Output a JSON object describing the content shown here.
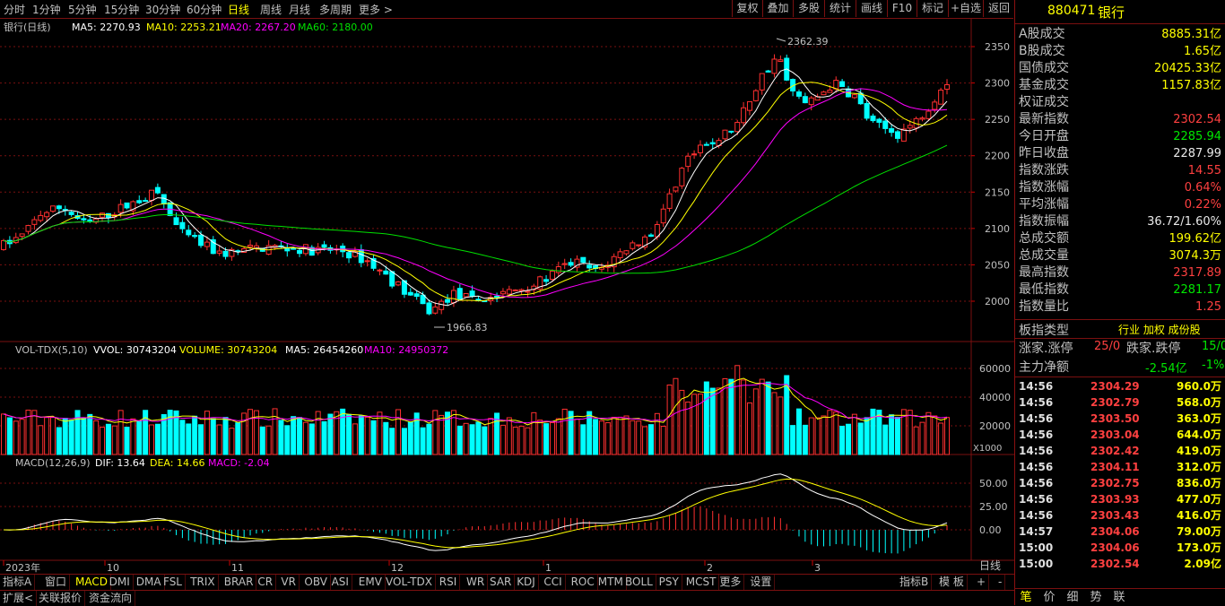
{
  "toolbar": {
    "periods": [
      "分时",
      "1分钟",
      "5分钟",
      "15分钟",
      "30分钟",
      "60分钟",
      "日线",
      "周线",
      "月线",
      "多周期",
      "更多 >"
    ],
    "selected_period": "日线",
    "right_buttons": [
      "复权",
      "叠加",
      "多股",
      "统计",
      "画线",
      "F10",
      "标记",
      "+自选",
      "返回"
    ]
  },
  "main_panel": {
    "title": "银行(日线)",
    "ma5": "MA5: 2270.93",
    "ma10": "MA10: 2253.21",
    "ma20": "MA20: 2267.20",
    "ma60": "MA60: 2180.00",
    "high_label": "2362.39",
    "low_label": "1966.83",
    "price_ticks": [
      "2350",
      "2300",
      "2250",
      "2200",
      "2150",
      "2100",
      "2050",
      "2000"
    ]
  },
  "vol_panel": {
    "title": "VOL-TDX(5,10)",
    "vvol": "VVOL: 30743204",
    "volume": "VOLUME: 30743204",
    "ma5": "MA5: 26454260",
    "ma10": "MA10: 24950372",
    "ticks": [
      "60000",
      "40000",
      "20000"
    ],
    "unit": "X1000"
  },
  "macd_panel": {
    "title": "MACD(12,26,9)",
    "dif": "DIF: 13.64",
    "dea": "DEA: 14.66",
    "macd": "MACD: -2.04",
    "ticks": [
      "50.00",
      "25.00",
      "0.00"
    ]
  },
  "date_axis": {
    "labels": [
      "2023年",
      "10",
      "11",
      "12",
      "1",
      "2",
      "3"
    ],
    "right_label": "日线"
  },
  "bottom_tabs": [
    "指标A",
    "窗口",
    "MACD",
    "DMI",
    "DMA",
    "FSL",
    "TRIX",
    "BRAR",
    "CR",
    "VR",
    "OBV",
    "ASI",
    "EMV",
    "VOL-TDX",
    "RSI",
    "WR",
    "SAR",
    "KDJ",
    "CCI",
    "ROC",
    "MTM",
    "BOLL",
    "PSY",
    "MCST",
    "更多",
    "设置"
  ],
  "bottom_tabs_selected": "MACD",
  "bottom_right_tabs": [
    "指标B",
    "模 板",
    "+",
    "-"
  ],
  "bottom_tabs2": [
    "扩展<",
    "关联报价",
    "资金流向"
  ],
  "quote": {
    "code": "880471",
    "name": "银行",
    "rows": [
      {
        "label": "A股成交",
        "value": "8885.31亿",
        "color": "yel"
      },
      {
        "label": "B股成交",
        "value": "1.65亿",
        "color": "yel"
      },
      {
        "label": "国债成交",
        "value": "20425.33亿",
        "color": "yel"
      },
      {
        "label": "基金成交",
        "value": "1157.83亿",
        "color": "yel"
      },
      {
        "label": "权证成交",
        "value": "",
        "color": "yel"
      },
      {
        "label": "最新指数",
        "value": "2302.54",
        "color": "red"
      },
      {
        "label": "今日开盘",
        "value": "2285.94",
        "color": "grn"
      },
      {
        "label": "昨日收盘",
        "value": "2287.99",
        "color": "wht"
      },
      {
        "label": "指数涨跌",
        "value": "14.55",
        "color": "red"
      },
      {
        "label": "指数涨幅",
        "value": "0.64%",
        "color": "red"
      },
      {
        "label": "平均涨幅",
        "value": "0.22%",
        "color": "red"
      },
      {
        "label": "指数振幅",
        "value": "36.72/1.60%",
        "color": "wht"
      },
      {
        "label": "总成交额",
        "value": "199.62亿",
        "color": "yel"
      },
      {
        "label": "总成交量",
        "value": "3074.3万",
        "color": "yel"
      },
      {
        "label": "最高指数",
        "value": "2317.89",
        "color": "red"
      },
      {
        "label": "最低指数",
        "value": "2281.17",
        "color": "grn"
      },
      {
        "label": "指数量比",
        "value": "1.25",
        "color": "red"
      }
    ],
    "type_label": "板指类型",
    "type_value": "行业 加权 成份股",
    "up_label": "涨家.涨停",
    "up_value": "25/0",
    "down_label": "跌家.跌停",
    "down_value": "15/0",
    "flow_label": "主力净额",
    "flow_value": "-2.54亿",
    "flow_pct": "-1%",
    "ticks": [
      {
        "t": "14:56",
        "p": "2304.29",
        "v": "960.0万"
      },
      {
        "t": "14:56",
        "p": "2302.79",
        "v": "568.0万"
      },
      {
        "t": "14:56",
        "p": "2303.50",
        "v": "363.0万"
      },
      {
        "t": "14:56",
        "p": "2303.04",
        "v": "644.0万"
      },
      {
        "t": "14:56",
        "p": "2302.42",
        "v": "419.0万"
      },
      {
        "t": "14:56",
        "p": "2304.11",
        "v": "312.0万"
      },
      {
        "t": "14:56",
        "p": "2302.75",
        "v": "836.0万"
      },
      {
        "t": "14:56",
        "p": "2303.93",
        "v": "477.0万"
      },
      {
        "t": "14:56",
        "p": "2303.43",
        "v": "416.0万"
      },
      {
        "t": "14:57",
        "p": "2304.06",
        "v": "79.00万"
      },
      {
        "t": "15:00",
        "p": "2304.06",
        "v": "173.0万"
      },
      {
        "t": "15:00",
        "p": "2302.54",
        "v": "2.09亿"
      }
    ],
    "bottom_tabs": [
      "笔",
      "价",
      "细",
      "势",
      "联"
    ]
  },
  "colors": {
    "up": "#ff3030",
    "down": "#00ffff",
    "ma5": "#ffffff",
    "ma10": "#ffff00",
    "ma20": "#ff00ff",
    "ma60": "#00e000",
    "grid": "#7a1010"
  }
}
